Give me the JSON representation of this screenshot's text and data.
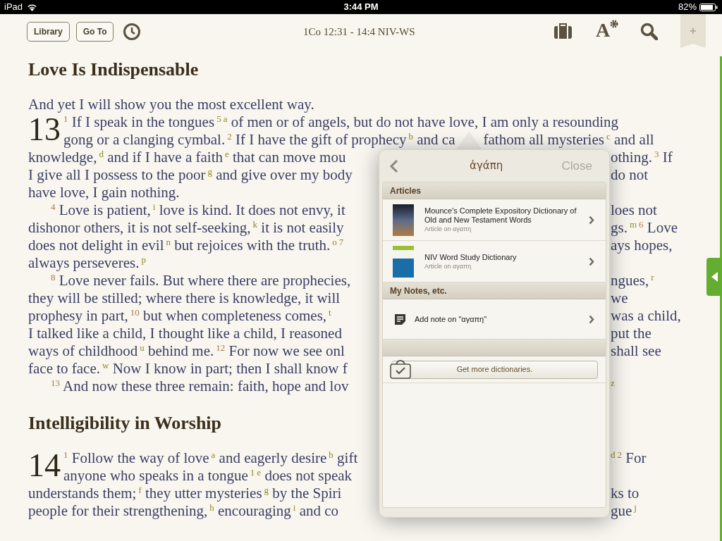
{
  "status_bar": {
    "device": "iPad",
    "time": "3:44 PM",
    "battery": "82%"
  },
  "toolbar": {
    "buttons": [
      "Library",
      "Go To"
    ],
    "reference": "1Co 12:31 - 14:4 NIV-WS",
    "font_button": "A",
    "bookmark": "+"
  },
  "passage": [
    {
      "kind": "heading",
      "text": "Love Is Indispensable"
    },
    {
      "kind": "text",
      "left": [
        {
          "kind": "text",
          "text": "And yet I will show you the most excellent way."
        }
      ]
    },
    {
      "kind": "chapter",
      "chapter": "13",
      "left": [
        {
          "kind": "verse",
          "text": "1"
        },
        {
          "kind": "text",
          "text": " If I speak in the tongues"
        },
        {
          "kind": "note",
          "text": "5"
        },
        {
          "kind": "note",
          "text": "a"
        },
        {
          "kind": "text",
          "text": " of men or of angels, but do not have love, I am only a resounding"
        }
      ]
    },
    {
      "kind": "hanging",
      "left": [
        {
          "kind": "text",
          "text": "gong or a clanging cymbal."
        },
        {
          "kind": "verse",
          "text": "2"
        },
        {
          "kind": "text",
          "text": " If I have the gift of prophecy"
        },
        {
          "kind": "note",
          "text": "b"
        },
        {
          "kind": "text",
          "text": " and ca"
        },
        {
          "kind": "pointer"
        },
        {
          "kind": "text",
          "text": "fathom all mysteries"
        },
        {
          "kind": "note",
          "text": "c"
        },
        {
          "kind": "text",
          "text": " and all"
        }
      ]
    },
    {
      "kind": "text",
      "left": [
        {
          "kind": "text",
          "text": "knowledge,"
        },
        {
          "kind": "note",
          "text": "d"
        },
        {
          "kind": "text",
          "text": " and if I have a faith"
        },
        {
          "kind": "note",
          "text": "e"
        },
        {
          "kind": "text",
          "text": " that can move mou"
        }
      ],
      "right": [
        {
          "kind": "text",
          "text": "othing."
        },
        {
          "kind": "verse",
          "text": "3"
        },
        {
          "kind": "text",
          "text": " If"
        }
      ]
    },
    {
      "kind": "text",
      "left": [
        {
          "kind": "text",
          "text": "I give all I possess to the poor"
        },
        {
          "kind": "note",
          "text": "g"
        },
        {
          "kind": "text",
          "text": " and give over my body"
        }
      ],
      "right": [
        {
          "kind": "text",
          "text": "do not"
        }
      ]
    },
    {
      "kind": "text",
      "left": [
        {
          "kind": "text",
          "text": "have love, I gain nothing."
        }
      ]
    },
    {
      "kind": "indent",
      "left": [
        {
          "kind": "verse",
          "text": "4"
        },
        {
          "kind": "text",
          "text": " Love is patient,"
        },
        {
          "kind": "note",
          "text": "i"
        },
        {
          "kind": "text",
          "text": " love is kind. It does not envy, it"
        }
      ],
      "right": [
        {
          "kind": "text",
          "text": "loes not"
        }
      ]
    },
    {
      "kind": "text",
      "left": [
        {
          "kind": "text",
          "text": "dishonor others, it is not self-seeking,"
        },
        {
          "kind": "note",
          "text": "k"
        },
        {
          "kind": "text",
          "text": " it is not easily"
        }
      ],
      "right": [
        {
          "kind": "text",
          "text": "gs."
        },
        {
          "kind": "note",
          "text": "m"
        },
        {
          "kind": "verse",
          "text": "6"
        },
        {
          "kind": "text",
          "text": " Love"
        }
      ]
    },
    {
      "kind": "text",
      "left": [
        {
          "kind": "text",
          "text": "does not delight in evil"
        },
        {
          "kind": "note",
          "text": "n"
        },
        {
          "kind": "text",
          "text": " but rejoices with the truth."
        },
        {
          "kind": "note",
          "text": "o"
        },
        {
          "kind": "verse",
          "text": "7"
        }
      ],
      "right": [
        {
          "kind": "text",
          "text": "ays hopes,"
        }
      ]
    },
    {
      "kind": "text",
      "left": [
        {
          "kind": "text",
          "text": "always perseveres."
        },
        {
          "kind": "note",
          "text": "p"
        }
      ]
    },
    {
      "kind": "indent",
      "left": [
        {
          "kind": "verse",
          "text": "8"
        },
        {
          "kind": "text",
          "text": " Love never fails. But where there are prophecies,"
        }
      ],
      "right": [
        {
          "kind": "text",
          "text": "ngues,"
        },
        {
          "kind": "note",
          "text": "r"
        }
      ]
    },
    {
      "kind": "text",
      "left": [
        {
          "kind": "text",
          "text": "they will be stilled; where there is knowledge, it will"
        }
      ],
      "right": [
        {
          "kind": "text",
          "text": "we"
        }
      ]
    },
    {
      "kind": "text",
      "left": [
        {
          "kind": "text",
          "text": "prophesy in part,"
        },
        {
          "kind": "verse",
          "text": "10"
        },
        {
          "kind": "text",
          "text": " but when completeness comes,"
        },
        {
          "kind": "note",
          "text": "t"
        }
      ],
      "right": [
        {
          "kind": "text",
          "text": "was a child,"
        }
      ]
    },
    {
      "kind": "text",
      "left": [
        {
          "kind": "text",
          "text": "I talked like a child, I thought like a child, I reasoned"
        }
      ],
      "right": [
        {
          "kind": "text",
          "text": "put the"
        }
      ]
    },
    {
      "kind": "text",
      "left": [
        {
          "kind": "text",
          "text": "ways of childhood"
        },
        {
          "kind": "note",
          "text": "u"
        },
        {
          "kind": "text",
          "text": " behind me."
        },
        {
          "kind": "verse",
          "text": "12"
        },
        {
          "kind": "text",
          "text": " For now we see onl"
        }
      ],
      "right": [
        {
          "kind": "text",
          "text": "shall see"
        }
      ]
    },
    {
      "kind": "text",
      "left": [
        {
          "kind": "text",
          "text": "face to face."
        },
        {
          "kind": "note",
          "text": "w"
        },
        {
          "kind": "text",
          "text": " Now I know in part; then I shall know f"
        }
      ]
    },
    {
      "kind": "indent",
      "left": [
        {
          "kind": "verse",
          "text": "13"
        },
        {
          "kind": "text",
          "text": " And now these three remain: faith, hope and lov"
        }
      ],
      "right": [
        {
          "kind": "note",
          "text": "z"
        }
      ]
    },
    {
      "kind": "heading",
      "text": "Intelligibility in Worship"
    },
    {
      "kind": "chapter",
      "chapter": "14",
      "left": [
        {
          "kind": "verse",
          "text": "1"
        },
        {
          "kind": "text",
          "text": " Follow the way of love"
        },
        {
          "kind": "note",
          "text": "a"
        },
        {
          "kind": "text",
          "text": " and eagerly desire"
        },
        {
          "kind": "note",
          "text": "b"
        },
        {
          "kind": "text",
          "text": " gift"
        }
      ],
      "right": [
        {
          "kind": "note",
          "text": "d"
        },
        {
          "kind": "verse",
          "text": "2"
        },
        {
          "kind": "text",
          "text": " For"
        }
      ]
    },
    {
      "kind": "hanging",
      "left": [
        {
          "kind": "text",
          "text": "anyone who speaks in a tongue"
        },
        {
          "kind": "note",
          "text": "1"
        },
        {
          "kind": "note",
          "text": "e"
        },
        {
          "kind": "text",
          "text": " does not speak"
        }
      ]
    },
    {
      "kind": "text",
      "left": [
        {
          "kind": "text",
          "text": "understands them;"
        },
        {
          "kind": "note",
          "text": "f"
        },
        {
          "kind": "text",
          "text": " they utter mysteries"
        },
        {
          "kind": "note",
          "text": "g"
        },
        {
          "kind": "text",
          "text": " by the Spiri"
        }
      ],
      "right": [
        {
          "kind": "text",
          "text": "ks to"
        }
      ]
    },
    {
      "kind": "text",
      "left": [
        {
          "kind": "text",
          "text": "people for their strengthening,"
        },
        {
          "kind": "note",
          "text": "h"
        },
        {
          "kind": "text",
          "text": " encouraging"
        },
        {
          "kind": "note",
          "text": "i"
        },
        {
          "kind": "text",
          "text": " and co"
        }
      ],
      "right": [
        {
          "kind": "text",
          "text": "gue"
        },
        {
          "kind": "note",
          "text": "j"
        }
      ]
    }
  ],
  "popover": {
    "title": "ἀγάπη",
    "close": "Close",
    "sections": [
      {
        "title": "Articles",
        "items": [
          {
            "kind": "article",
            "title": "Mounce's Complete Expository Dictionary of Old and New Testament Words",
            "subtitle": "Article on αγαπη"
          },
          {
            "kind": "article",
            "title": "NIV Word Study Dictionary",
            "subtitle": "Article on αγαπη"
          }
        ]
      },
      {
        "title": "My Notes, etc.",
        "items": [
          {
            "kind": "note",
            "title": "Add note on \"αγαπη\""
          }
        ]
      }
    ],
    "store_button": "Get more dictionaries."
  }
}
